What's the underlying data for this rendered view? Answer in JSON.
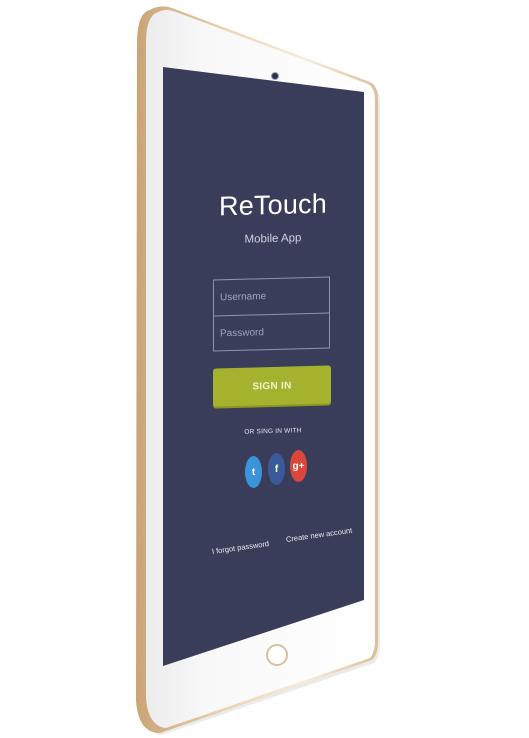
{
  "app": {
    "title": "ReTouch",
    "subtitle": "Mobile App"
  },
  "login": {
    "username_placeholder": "Username",
    "password_placeholder": "Password",
    "signin_label": "SIGN IN"
  },
  "social": {
    "heading": "OR SING IN WITH",
    "buttons": [
      {
        "name": "twitter",
        "glyph": "t",
        "icon": "twitter-icon",
        "color": "#3b94d9"
      },
      {
        "name": "facebook",
        "glyph": "f",
        "icon": "facebook-icon",
        "color": "#3b5a9a"
      },
      {
        "name": "google-plus",
        "glyph": "g+",
        "icon": "google-plus-icon",
        "color": "#d9463a"
      }
    ]
  },
  "links": {
    "forgot": "I forgot password",
    "create": "Create new account"
  },
  "colors": {
    "screen_bg": "#3a3d5a",
    "accent": "#a4b22d",
    "device_edge": "#e6cba8"
  }
}
